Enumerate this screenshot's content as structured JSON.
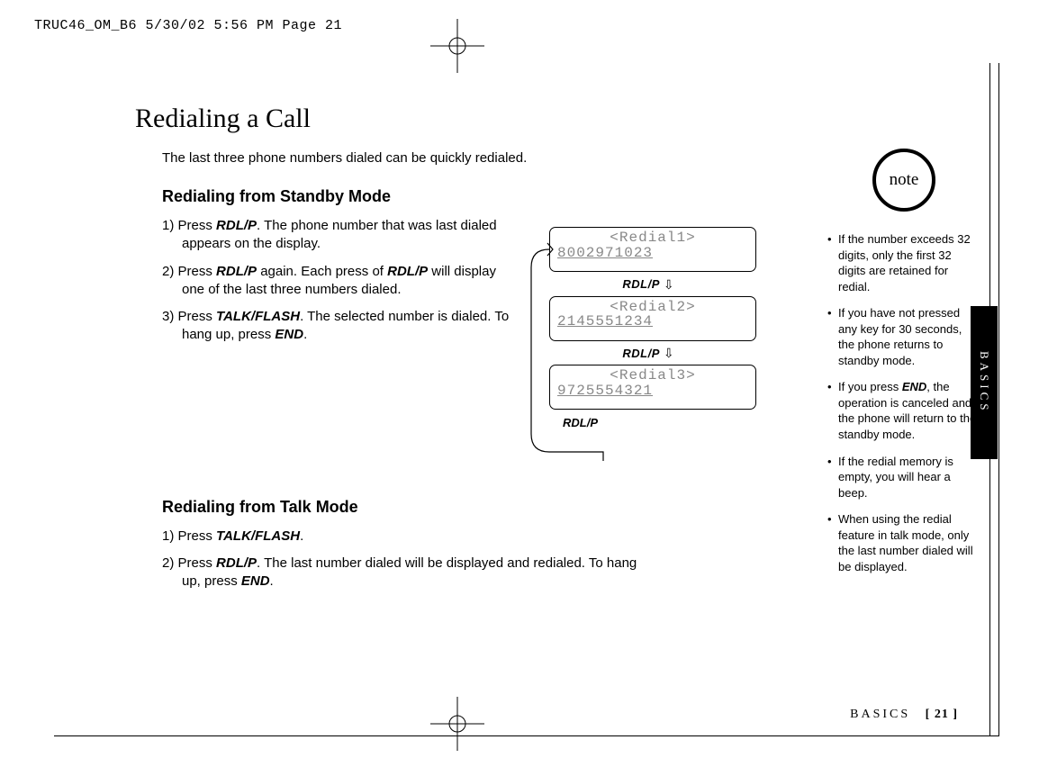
{
  "header": {
    "slug": "TRUC46_OM_B6  5/30/02  5:56 PM  Page 21"
  },
  "title": "Redialing a Call",
  "intro": "The last three phone numbers dialed can be quickly redialed.",
  "standby": {
    "heading": "Redialing from Standby Mode",
    "steps": [
      {
        "n": "1)",
        "pre": "Press ",
        "key": "RDL/P",
        "post": ". The phone number that was last dialed appears on the display."
      },
      {
        "n": "2)",
        "pre": "Press ",
        "key": "RDL/P",
        "mid": " again. Each press of ",
        "key2": "RDL/P",
        "post": " will display one of the last three numbers dialed."
      },
      {
        "n": "3)",
        "pre": "Press ",
        "key": "TALK/FLASH",
        "mid": ". The selected number is dialed. To hang up, press ",
        "key2": "END",
        "post": "."
      }
    ]
  },
  "talk": {
    "heading": "Redialing from Talk Mode",
    "steps": [
      {
        "n": "1)",
        "pre": "Press ",
        "key": "TALK/FLASH",
        "post": "."
      },
      {
        "n": "2)",
        "pre": "Press ",
        "key": "RDL/P",
        "mid": ". The last number dialed will be displayed and redialed. To hang up, press ",
        "key2": "END",
        "post": "."
      }
    ]
  },
  "lcd": {
    "screens": [
      {
        "label": "<Redial1>",
        "number": "8002971023"
      },
      {
        "label": "<Redial2>",
        "number": "2145551234"
      },
      {
        "label": "<Redial3>",
        "number": "9725554321"
      }
    ],
    "btn": "RDL/P"
  },
  "sidebar": {
    "note_label": "note",
    "tab": "BASICS",
    "items": [
      "If the number exceeds 32 digits, only the first 32 digits are retained for redial.",
      "If you have not pressed any key for 30 seconds, the phone returns to standby mode.",
      "If you press <k>END</k>, the operation is canceled and the phone will return to the standby mode.",
      "If the redial memory is empty, you will hear a beep.",
      "When using the redial feature in talk mode, only the last number dialed will be displayed."
    ]
  },
  "footer": {
    "section": "BASICS",
    "page": "[ 21 ]"
  }
}
